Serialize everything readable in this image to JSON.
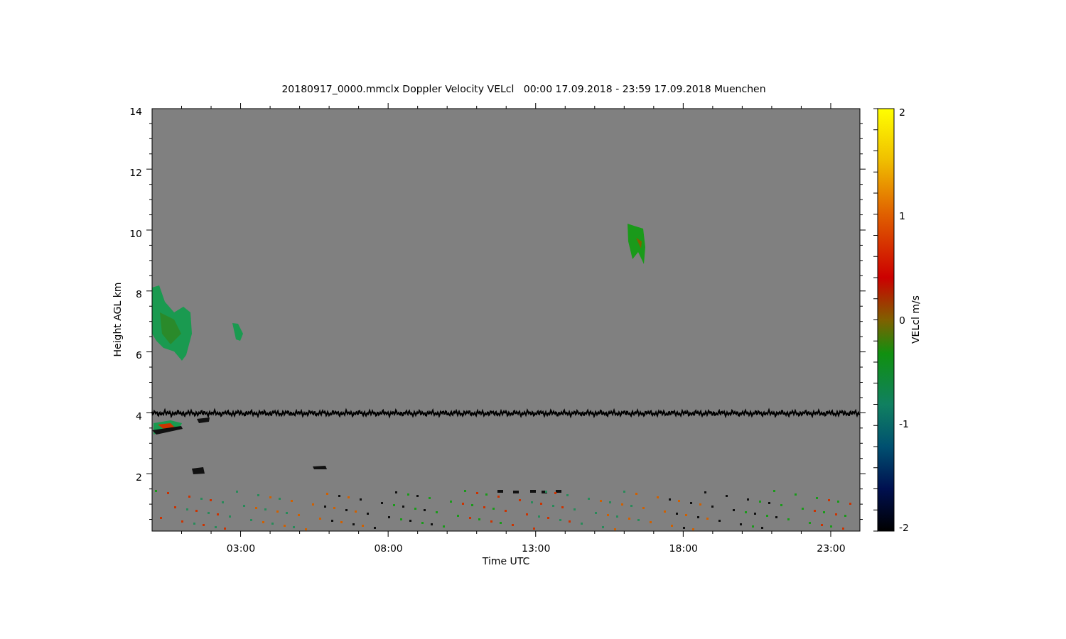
{
  "title": "20180917_0000.mmclx Doppler Velocity VELcl   00:00 17.09.2018 - 23:59 17.09.2018 Muenchen",
  "y_axis": {
    "label": "Height AGL km",
    "ticks": [
      "14",
      "12",
      "10",
      "8",
      "6",
      "4",
      "2"
    ]
  },
  "x_axis": {
    "label": "Time UTC",
    "ticks": [
      "03:00",
      "08:00",
      "13:00",
      "18:00",
      "23:00"
    ]
  },
  "colorbar": {
    "label": "VELcl m/s",
    "ticks": [
      "2",
      "1",
      "0",
      "-1",
      "-2"
    ]
  }
}
